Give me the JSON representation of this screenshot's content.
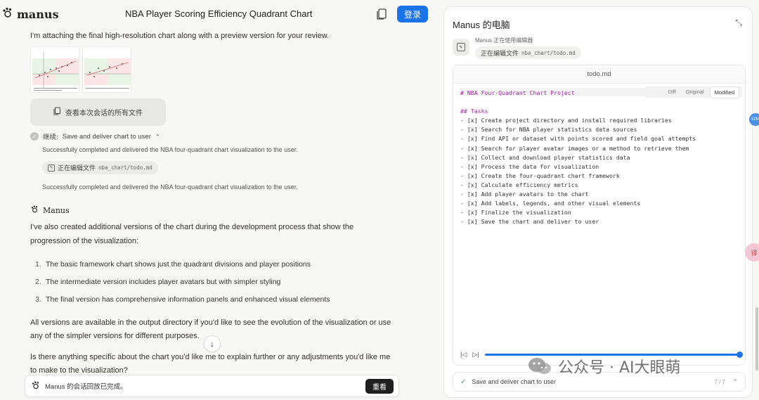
{
  "header": {
    "brand": "manus",
    "title": "NBA Player Scoring Efficiency Quadrant Chart",
    "login": "登录"
  },
  "chat": {
    "intro": "I'm attaching the final high-resolution chart along with a preview version for your review.",
    "files_button": "查看本次会话的所有文件",
    "step_label": "继续:",
    "step_title": "Save and deliver chart to user",
    "step_note_1": "Successfully completed and delivered the NBA four-quadrant chart visualization to the user.",
    "pill_label": "正在编辑文件",
    "pill_file": "nba_chart/todo.md",
    "step_note_2": "Successfully completed and delivered the NBA four-quadrant chart visualization to the user.",
    "agent_name": "Manus",
    "para1_a": "I've also created additional versions of the chart during the development process that show the",
    "para1_b": "progression of the visualization:",
    "list": [
      {
        "num": "1.",
        "text": "The basic framework chart shows just the quadrant divisions and player positions"
      },
      {
        "num": "2.",
        "text": "The intermediate version includes player avatars but with simpler styling"
      },
      {
        "num": "3.",
        "text": "The final version has comprehensive information panels and enhanced visual elements"
      }
    ],
    "para2_a": "All versions are available in the output directory if you'd like to see the evolution of the visualization or use",
    "para2_b": "any of the simpler versions for different purposes.",
    "para3_a": "Is there anything specific about the chart you'd like me to explain further or any adjustments you'd like me",
    "para3_b": "to make to the visualization?",
    "bottom_status": "Manus 的会话回放已完成。",
    "replay_button": "重看"
  },
  "computer": {
    "title": "Manus 的电脑",
    "status": "Manus 正在使用编辑器",
    "pill_label": "正在编辑文件",
    "pill_file": "nba_chart/todo.md",
    "editor_filename": "todo.md",
    "tabs": [
      "Diff",
      "Original",
      "Modified"
    ],
    "active_tab": "Modified",
    "code_lines": [
      {
        "text": "# NBA Four-Quadrant Chart Project",
        "style": "purple"
      },
      {
        "text": "",
        "style": ""
      },
      {
        "text": "## Tasks",
        "style": "purple"
      },
      {
        "text": "- [x] Create project directory and install required libraries",
        "style": ""
      },
      {
        "text": "- [x] Search for NBA player statistics data sources",
        "style": ""
      },
      {
        "text": "- [x] Find API or dataset with points scored and field goal attempts",
        "style": ""
      },
      {
        "text": "- [x] Search for player avatar images or a method to retrieve them",
        "style": ""
      },
      {
        "text": "- [x] Collect and download player statistics data",
        "style": ""
      },
      {
        "text": "- [x] Process the data for visualization",
        "style": ""
      },
      {
        "text": "- [x] Create the four-quadrant chart framework",
        "style": ""
      },
      {
        "text": "- [x] Calculate efficiency metrics",
        "style": ""
      },
      {
        "text": "- [x] Add player avatars to the chart",
        "style": ""
      },
      {
        "text": "- [x] Add labels, legends, and other visual elements",
        "style": ""
      },
      {
        "text": "- [x] Finalize the visualization",
        "style": ""
      },
      {
        "text": "- [x] Save the chart and deliver to user",
        "style": ""
      }
    ],
    "progress": 1.0,
    "footer_task": "Save and deliver chart to user",
    "footer_count": "7 / 7"
  },
  "overlay": {
    "side_badge": "52M",
    "translate": "译",
    "watermark": "公众号 · AI大眼萌"
  },
  "colors": {
    "accent": "#1a73e8",
    "code_heading": "#a626a4",
    "success": "#3aa55b"
  }
}
